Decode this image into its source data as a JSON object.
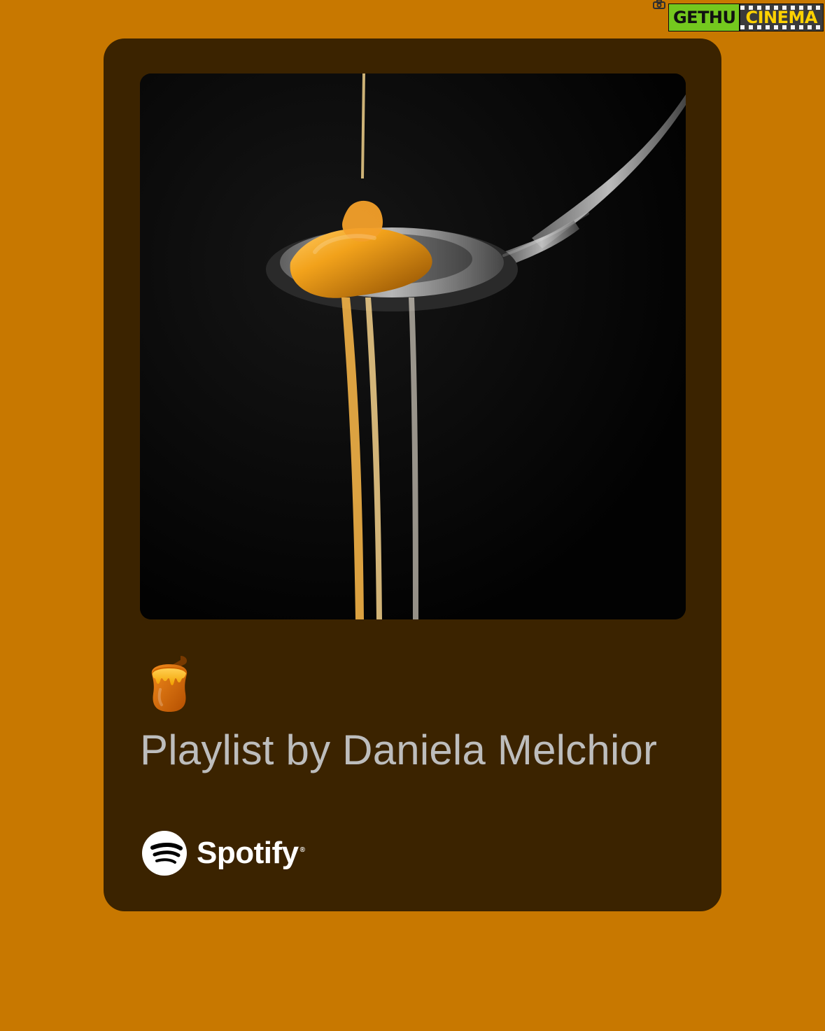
{
  "watermark": {
    "left_text": "GETHU",
    "right_text": "CINEMA",
    "camera_icon": "camera-icon"
  },
  "card": {
    "cover_image_alt": "honey-dripping-from-spoon-image",
    "emoji_icon": "honey-pot-icon",
    "title": "Playlist by Daniela Melchior",
    "brand": {
      "name": "Spotify",
      "registered_mark": "®",
      "logo_icon": "spotify-logo-icon"
    }
  },
  "colors": {
    "page_background": "#c87800",
    "card_background": "#3b2300",
    "title_text": "#bdbdbd",
    "brand_text": "#ffffff",
    "watermark_green": "#74c81e",
    "watermark_dark": "#3b3b3b",
    "watermark_yellow": "#ffd200"
  }
}
